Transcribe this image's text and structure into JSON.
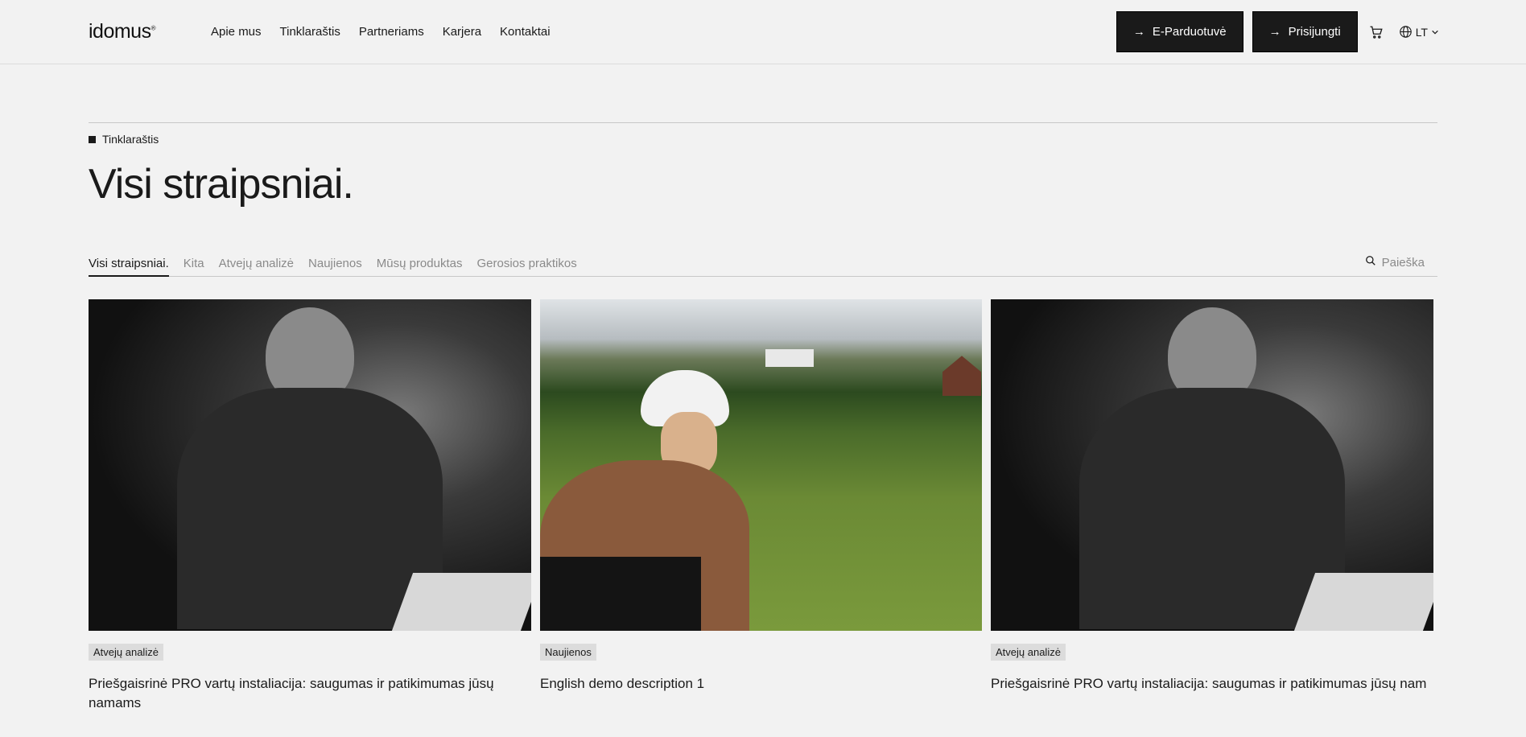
{
  "header": {
    "logo": "idomus",
    "nav": [
      "Apie mus",
      "Tinklaraštis",
      "Partneriams",
      "Karjera",
      "Kontaktai"
    ],
    "shop_label": "E-Parduotuvė",
    "login_label": "Prisijungti",
    "lang": "LT"
  },
  "main": {
    "breadcrumb": "Tinklaraštis",
    "title": "Visi straipsniai.",
    "tabs": [
      "Visi straipsniai.",
      "Kita",
      "Atvejų analizė",
      "Naujienos",
      "Mūsų produktas",
      "Gerosios praktikos"
    ],
    "active_tab": 0,
    "search_label": "Paieška"
  },
  "cards": [
    {
      "badge": "Atvejų analizė",
      "title": "Priešgaisrinė PRO vartų instaliacija: saugumas ir patikimumas jūsų namams",
      "image": "worker-photo"
    },
    {
      "badge": "Naujienos",
      "title": "English demo description 1",
      "image": "cyclist-photo"
    },
    {
      "badge": "Atvejų analizė",
      "title": "Priešgaisrinė PRO vartų instaliacija: saugumas ir patikimumas jūsų nam",
      "image": "worker-photo"
    }
  ],
  "icons": {
    "arrow": "arrow-right-icon",
    "cart": "cart-icon",
    "globe": "globe-icon",
    "chevron": "chevron-down-icon",
    "search": "search-icon"
  }
}
